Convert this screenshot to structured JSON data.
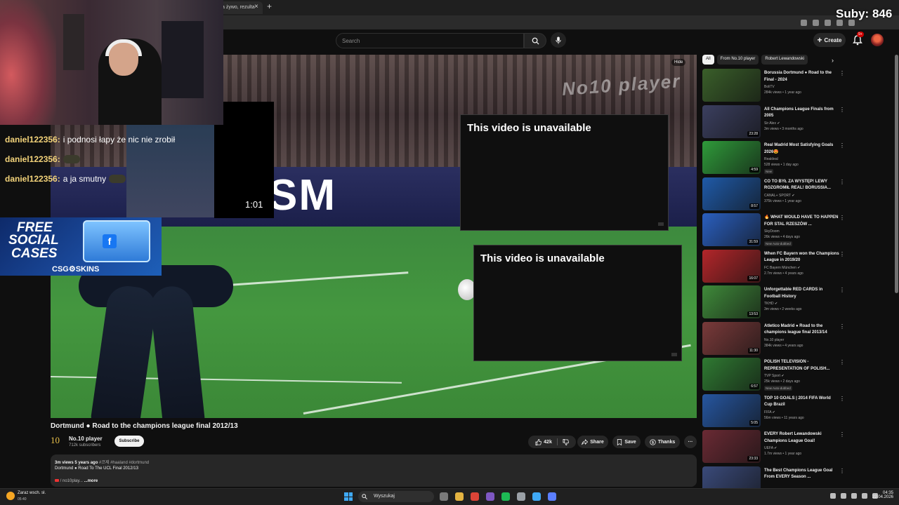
{
  "browser": {
    "active_tab_title": "a żywo, rezulta",
    "tab_close": "×",
    "new_tab": "+"
  },
  "stream_overlay": {
    "subs_counter": "Suby: 846",
    "cam_timer": "1:01",
    "chat": [
      {
        "user": "daniel122356:",
        "message": "i podnosi łapy że nic nie zrobił",
        "emote": false
      },
      {
        "user": "daniel122356:",
        "message": "",
        "emote": true
      },
      {
        "user": "daniel122356:",
        "message": "a ja smutny",
        "emote": true
      }
    ],
    "promo": {
      "line1": "FREE",
      "line2": "SOCIAL",
      "line3": "CASES",
      "fb_letter": "f",
      "brand": "CSG⚙SKINS"
    }
  },
  "header": {
    "search_placeholder": "Search",
    "create_label": "Create",
    "notif_badge": "9+"
  },
  "player": {
    "hide_label": "Hide",
    "ad_board_text": "SM",
    "watermark": "No10 player",
    "unavailable_1": "This video is unavailable",
    "unavailable_2": "This video is unavailable"
  },
  "video": {
    "title": "Dortmund ● Road to the champions league final 2012/13",
    "channel_logo": "10",
    "channel_name": "No.10 player",
    "channel_subs": "712k subscribers",
    "subscribe_label": "Subscribe",
    "likes": "42k",
    "share_label": "Share",
    "save_label": "Save",
    "thanks_label": "Thanks",
    "more_label": "···",
    "desc_views": "3m views  5 years ago",
    "desc_tags": "#코제 #haaland #dortmund",
    "desc_line": "Dortmund ● Road To The UCL Final 2012/13",
    "desc_link": "/ no10play...",
    "desc_more": "...more"
  },
  "sidebar": {
    "chips": [
      "All",
      "From No.10 player",
      "Robert Lewandowski"
    ],
    "chip_arrow": "›",
    "recommendations": [
      {
        "title": "Borussia Dortmund ● Road to the Final - 2024",
        "channel": "BoliTV",
        "meta": "284k views • 1 year ago",
        "duration": "",
        "badge": "",
        "thumb": "#3a5f2a"
      },
      {
        "title": "All Champions League Finals from 2005",
        "channel": "Sir Alex ✔",
        "meta": "3m views • 3 months ago",
        "duration": "23:28",
        "badge": "",
        "thumb": "#3b3f5f"
      },
      {
        "title": "Real Madrid Most Satisfying Goals 2026😍",
        "channel": "Realdeal",
        "meta": "528 views • 1 day ago",
        "duration": "4:59",
        "badge": "New",
        "thumb": "#2f9a3a"
      },
      {
        "title": "CO TO BYŁ ZA WYSTĘP! LEWY ROZGROMIŁ REAL! BORUSSIA...",
        "channel": "CANAL+ SPORT ✔",
        "meta": "375k views • 1 year ago",
        "duration": "8:57",
        "badge": "",
        "thumb": "#1f5aa8"
      },
      {
        "title": "🔥 WHAT WOULD HAVE TO HAPPEN FOR STAL RZESZÓW ...",
        "channel": "SkyDoom",
        "meta": "26k views • 4 days ago",
        "duration": "31:59",
        "badge": "New  Auto-dubbed",
        "thumb": "#2a5fbf"
      },
      {
        "title": "When FC Bayern won the Champions League in 2019/20",
        "channel": "FC Bayern München ✔",
        "meta": "2.7m views • 4 years ago",
        "duration": "16:07",
        "badge": "",
        "thumb": "#b3262a"
      },
      {
        "title": "Unforgettable RED CARDS in Football History",
        "channel": "TKHD ✔",
        "meta": "3m views • 2 weeks ago",
        "duration": "13:53",
        "badge": "",
        "thumb": "#3f8a3a"
      },
      {
        "title": "Atletico Madrid ● Road to the champions league final 2013/14",
        "channel": "No.10 player",
        "meta": "384k views • 4 years ago",
        "duration": "11:30",
        "badge": "",
        "thumb": "#7a3a3a"
      },
      {
        "title": "POLISH TELEVISION - REPRESENTATION OF POLISH...",
        "channel": "TVP Sport ✔",
        "meta": "25k views • 2 days ago",
        "duration": "6:57",
        "badge": "New  Auto-dubbed",
        "thumb": "#2f7a32"
      },
      {
        "title": "TOP 10 GOALS | 2014 FIFA World Cup Brazil",
        "channel": "FIFA ✔",
        "meta": "56m views • 11 years ago",
        "duration": "5:05",
        "badge": "",
        "thumb": "#2656a0"
      },
      {
        "title": "EVERY Robert Lewandowski Champions League Goal!",
        "channel": "UEFA ✔",
        "meta": "1.7m views • 1 year ago",
        "duration": "23:33",
        "badge": "",
        "thumb": "#6a2a34"
      },
      {
        "title": "The Best Champions League Goal From EVERY Season ...",
        "channel": "",
        "meta": "",
        "duration": "",
        "badge": "",
        "thumb": "#3a4a7a"
      }
    ]
  },
  "taskbar": {
    "weather_text": "Zaraz wsch. sł.",
    "weather_time": "05:40",
    "search_label": "Wyszukaj",
    "time": "04:35",
    "date": "22.04.2026",
    "app_colors": [
      "#7a7a7a",
      "#e3b341",
      "#db4437",
      "#7e57c2",
      "#1db954",
      "#9aa0a6",
      "#3fa9f5",
      "#5b7fff"
    ]
  }
}
